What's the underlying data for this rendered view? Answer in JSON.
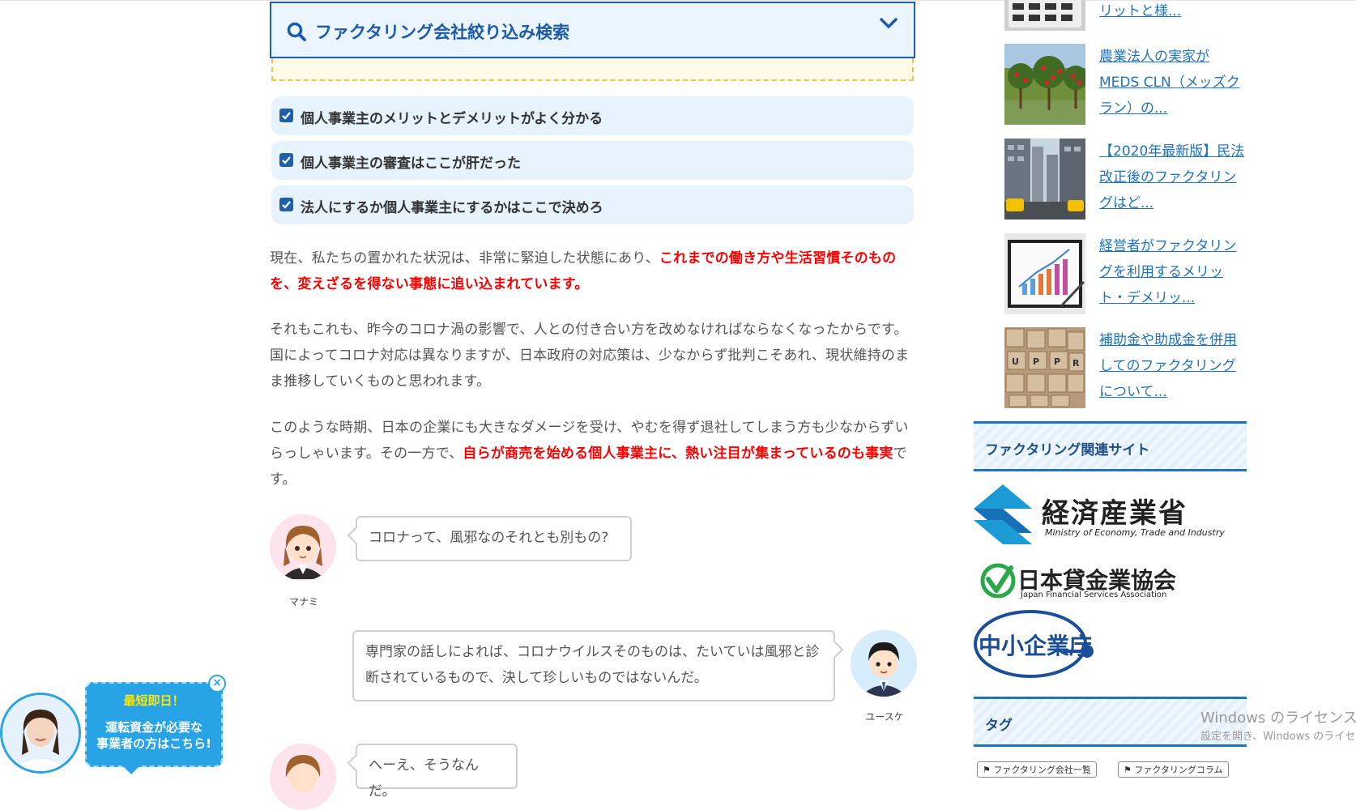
{
  "search": {
    "title": "ファクタリング会社絞り込み検索"
  },
  "checklist": [
    "個人事業主のメリットとデメリットがよく分かる",
    "個人事業主の審査はここが肝だった",
    "法人にするか個人事業主にするかはここで決めろ"
  ],
  "paragraphs": {
    "p1_a": "現在、私たちの置かれた状況は、非常に緊迫した状態にあり、",
    "p1_b": "これまでの働き方や生活習慣そのものを、変えざるを得ない事態に追い込まれています。",
    "p2": "それもこれも、昨今のコロナ渦の影響で、人との付き合い方を改めなければならなくなったからです。国によってコロナ対応は異なりますが、日本政府の対応策は、少なからず批判こそあれ、現状維持のまま推移していくものと思われます。",
    "p3_a": "このような時期、日本の企業にも大きなダメージを受け、やむを得ず退社してしまう方も少なからずいらっしゃいます。その一方で、",
    "p3_b": "自らが商売を始める個人事業主に、熱い注目が集まっているのも事実",
    "p3_c": "です。"
  },
  "dialogue": [
    {
      "speaker": "マナミ",
      "text": "コロナって、風邪なのそれとも別もの?"
    },
    {
      "speaker": "ユースケ",
      "text": "専門家の話しによれば、コロナウイルスそのものは、たいていは風邪と診断されているもので、決して珍しいものではないんだ。"
    },
    {
      "speaker": "",
      "text": "へーえ、そうなんだ。"
    }
  ],
  "sidebar": {
    "posts": [
      {
        "title": "リットと様..."
      },
      {
        "title": "農業法人の実家がMEDS CLN（メッズクラン）の..."
      },
      {
        "title": "【2020年最新版】民法改正後のファクタリングはど..."
      },
      {
        "title": "経営者がファクタリングを利用するメリット・デメリッ..."
      },
      {
        "title": "補助金や助成金を併用してのファクタリングについて..."
      }
    ],
    "related_heading": "ファクタリング関連サイト",
    "logos": {
      "meti_ja": "経済産業省",
      "meti_en": "Ministry of Economy, Trade and Industry",
      "jfsa_ja": "日本貸金業協会",
      "jfsa_en": "Japan Financial Services Association",
      "sme_ja": "中小企業庁"
    },
    "tags_heading": "タグ",
    "tags": [
      "ファクタリング会社一覧",
      "ファクタリングコラム"
    ]
  },
  "promo": {
    "line1": "最短即日！",
    "line2a": "運転資金が必要な",
    "line2b": "事業者の方はこちら!",
    "close": "×"
  },
  "watermark": {
    "line1": "Windows のライセンス認",
    "line2": "設定を開き、Windows のライセン"
  },
  "colors": {
    "accent": "#1e73be",
    "highlight": "#ff0000",
    "promo": "#27a3e6"
  }
}
